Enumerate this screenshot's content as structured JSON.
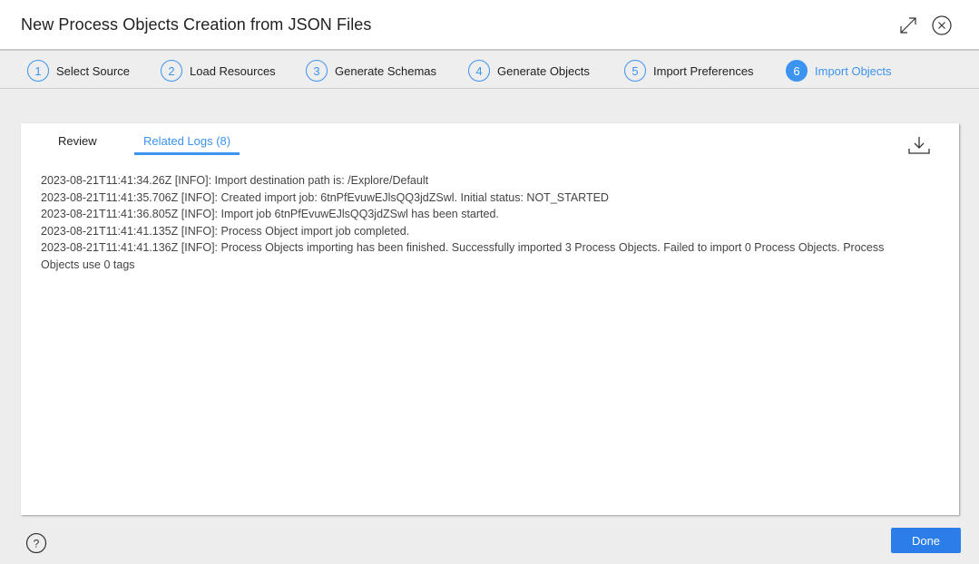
{
  "dialog": {
    "title": "New Process Objects Creation from JSON Files",
    "icons": {
      "expand": "expand-icon",
      "close": "close-icon"
    }
  },
  "stepper": {
    "steps": [
      {
        "number": "1",
        "label": "Select Source",
        "active": false
      },
      {
        "number": "2",
        "label": "Load Resources",
        "active": false
      },
      {
        "number": "3",
        "label": "Generate Schemas",
        "active": false
      },
      {
        "number": "4",
        "label": "Generate Objects",
        "active": false
      },
      {
        "number": "5",
        "label": "Import Preferences",
        "active": false
      },
      {
        "number": "6",
        "label": "Import Objects",
        "active": true
      }
    ],
    "accent_color": "#3d93f0"
  },
  "panel": {
    "tabs": [
      {
        "label": "Review",
        "active": false
      },
      {
        "label": "Related Logs (8)",
        "active": true
      }
    ],
    "download_icon": "download-icon",
    "logs": [
      "2023-08-21T11:41:34.26Z [INFO]: Import destination path is: /Explore/Default",
      "2023-08-21T11:41:35.706Z [INFO]: Created import job: 6tnPfEvuwEJlsQQ3jdZSwl. Initial status: NOT_STARTED",
      "2023-08-21T11:41:36.805Z [INFO]: Import job 6tnPfEvuwEJlsQQ3jdZSwl has been started.",
      "2023-08-21T11:41:41.135Z [INFO]: Process Object import job completed.",
      "2023-08-21T11:41:41.136Z [INFO]: Process Objects importing has been finished. Successfully imported 3 Process Objects. Failed to import 0 Process Objects. Process Objects use 0 tags"
    ]
  },
  "footer": {
    "help_icon": "help-icon",
    "done_label": "Done",
    "done_color": "#2b7de9"
  }
}
